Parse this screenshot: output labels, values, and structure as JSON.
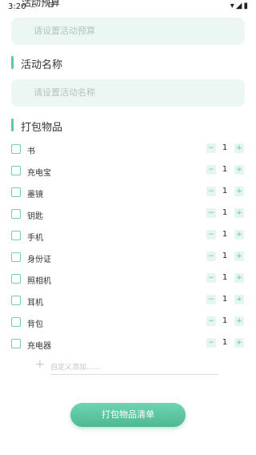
{
  "status_bar": {
    "time": "3:20",
    "left_icons": "⊥ ⊡",
    "right_icons": "▾◢▮"
  },
  "header": {
    "partial_title": "活动预算"
  },
  "budget": {
    "placeholder": "请设置活动预算"
  },
  "activity_name": {
    "title": "活动名称",
    "placeholder": "请设置活动名称"
  },
  "packing": {
    "title": "打包物品",
    "items": [
      {
        "label": "书",
        "qty": "1"
      },
      {
        "label": "充电宝",
        "qty": "1"
      },
      {
        "label": "墨镜",
        "qty": "1"
      },
      {
        "label": "钥匙",
        "qty": "1"
      },
      {
        "label": "手机",
        "qty": "1"
      },
      {
        "label": "身份证",
        "qty": "1"
      },
      {
        "label": "照相机",
        "qty": "1"
      },
      {
        "label": "耳机",
        "qty": "1"
      },
      {
        "label": "背包",
        "qty": "1"
      },
      {
        "label": "充电器",
        "qty": "1"
      }
    ],
    "stepper_minus": "−",
    "stepper_plus": "+",
    "add_icon": "+",
    "add_placeholder": "自定义添加......"
  },
  "button": {
    "label": "打包物品清单"
  },
  "colors": {
    "accent": "#5ccaa8",
    "input_bg": "#ecf7f4"
  }
}
